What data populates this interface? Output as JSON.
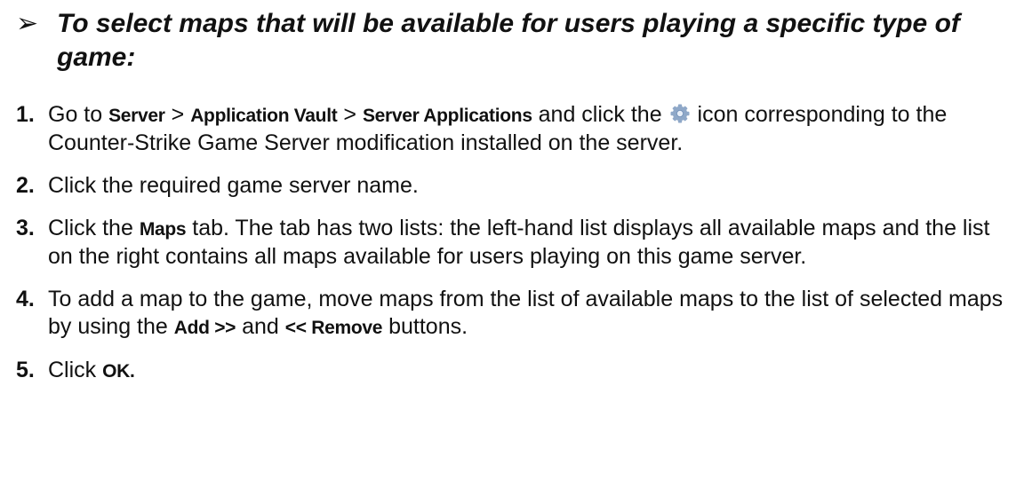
{
  "heading": {
    "bullet": "➢",
    "text": "To select maps that will be available for users playing a specific type of game:"
  },
  "steps": [
    {
      "number": "1.",
      "parts": {
        "t1": "Go to ",
        "ui1": "Server",
        "t2": " > ",
        "ui2": "Application Vault",
        "t3": " > ",
        "ui3": "Server Applications",
        "t4": " and click the ",
        "icon": "gear-icon",
        "t5": " icon corresponding to the Counter-Strike Game Server modification installed on the server."
      }
    },
    {
      "number": "2.",
      "parts": {
        "t1": "Click the required game server name."
      }
    },
    {
      "number": "3.",
      "parts": {
        "t1": "Click the ",
        "ui1": "Maps",
        "t2": " tab. The tab has two lists: the left-hand list displays all available maps and the list on the right contains all maps available for users playing on this game server."
      }
    },
    {
      "number": "4.",
      "parts": {
        "t1": "To add a map to the game, move maps from the list of available maps to the list of selected maps by using the ",
        "ui1": "Add >>",
        "t2": " and ",
        "ui2": "<< Remove",
        "t3": " buttons."
      }
    },
    {
      "number": "5.",
      "parts": {
        "t1": "Click ",
        "ui1": "OK."
      }
    }
  ],
  "colors": {
    "text": "#111111",
    "gear_outer": "#8fa8c8",
    "gear_inner": "#e6eef8"
  }
}
